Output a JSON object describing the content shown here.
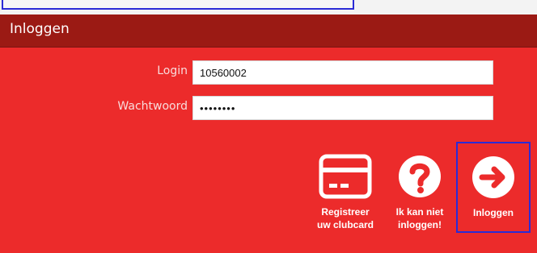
{
  "panel": {
    "title": "Inloggen"
  },
  "form": {
    "login_label": "Login",
    "login_value": "10560002",
    "password_label": "Wachtwoord",
    "password_value": "••••••••"
  },
  "actions": {
    "register_line1": "Registreer",
    "register_line2": "uw clubcard",
    "forgot_line1": "Ik kan niet",
    "forgot_line2": "inloggen!",
    "login_label": "Inloggen"
  },
  "icons": {
    "register": "credit-card-icon",
    "forgot": "question-icon",
    "login": "arrow-right-circle-icon"
  },
  "colors": {
    "panel": "#ec2b2b",
    "header": "#9b1a14",
    "highlight": "#2b2bd6"
  }
}
